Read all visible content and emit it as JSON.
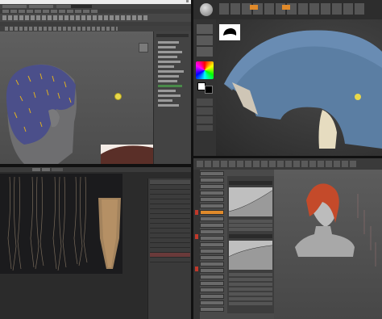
{
  "windows": {
    "maya_viewport": {
      "title": "",
      "menu": [
        "",
        "",
        "",
        "",
        "",
        "",
        "",
        ""
      ],
      "outliner": {
        "items": [
          "",
          "",
          "",
          "",
          "",
          "",
          "",
          "",
          "",
          "",
          "",
          "",
          "",
          ""
        ]
      },
      "helper_icon": "sun-icon",
      "inset_image": "hair-photo"
    },
    "zbrush": {
      "title": "",
      "tools": [
        "",
        "",
        "",
        "",
        "",
        ""
      ],
      "palette": "color-picker"
    },
    "xgen_preview": {
      "tabs": [
        "",
        ""
      ],
      "strands": 6,
      "settings_rows": 16
    },
    "texture_editor": {
      "buttons": 24,
      "curve_panels": 2
    }
  },
  "colors": {
    "maya_bg": "#5b5b5b",
    "zbrush_bg": "#3a3a3a",
    "skin": "#6e6e70",
    "hair_blue": "#4b4f8a",
    "helmet_blue": "#5b7ea3",
    "accent_orange": "#e08a2a",
    "red_hair": "#c44a2a"
  }
}
